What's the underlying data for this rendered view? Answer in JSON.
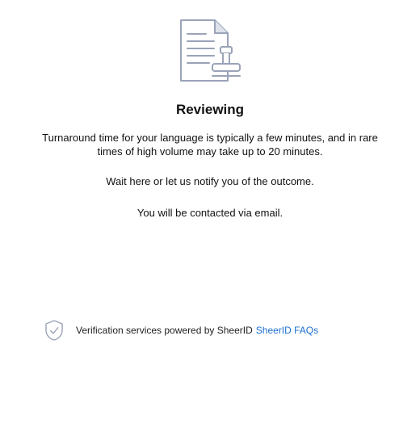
{
  "review": {
    "icon": "document-stamp-icon",
    "title": "Reviewing",
    "paragraphs": [
      "Turnaround time for your language is typically a few minutes, and in rare times of high volume may take up to 20 minutes.",
      "Wait here or let us notify you of the outcome.",
      "You will be contacted via email."
    ]
  },
  "footer": {
    "icon": "shield-check-icon",
    "powered_by": "Verification services powered by SheerID",
    "faq_link": "SheerID FAQs"
  },
  "colors": {
    "icon_stroke": "#9aa3b8",
    "link": "#1d6fd1",
    "text": "#111111"
  }
}
